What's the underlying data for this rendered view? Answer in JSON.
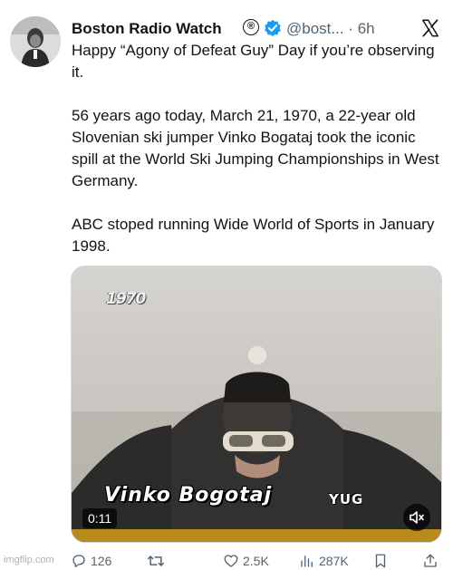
{
  "author": {
    "name": "Boston Radio Watch",
    "registered_mark": "®",
    "handle": "@bost...",
    "separator": "·",
    "time": "6h"
  },
  "tweet": {
    "paragraphs": [
      "Happy “Agony of Defeat Guy” Day if you’re observing it.",
      "56 years ago today, March 21, 1970, a 22-year old Slovenian ski jumper Vinko Bogataj took the iconic spill at the World Ski Jumping Championships in West Germany.",
      "ABC stoped running Wide World of Sports in January 1998."
    ]
  },
  "media": {
    "overlay_logo": "1970",
    "caption_name": "Vinko Bogotaj",
    "caption_country": "YUG",
    "duration": "0:11",
    "audio_state": "muted"
  },
  "actions": {
    "replies": "126",
    "reposts": "",
    "likes": "2.5K",
    "views": "287K"
  },
  "watermark": "imgflip.com",
  "colors": {
    "text": "#0f1419",
    "secondary": "#536471",
    "verified": "#1d9bf0"
  }
}
